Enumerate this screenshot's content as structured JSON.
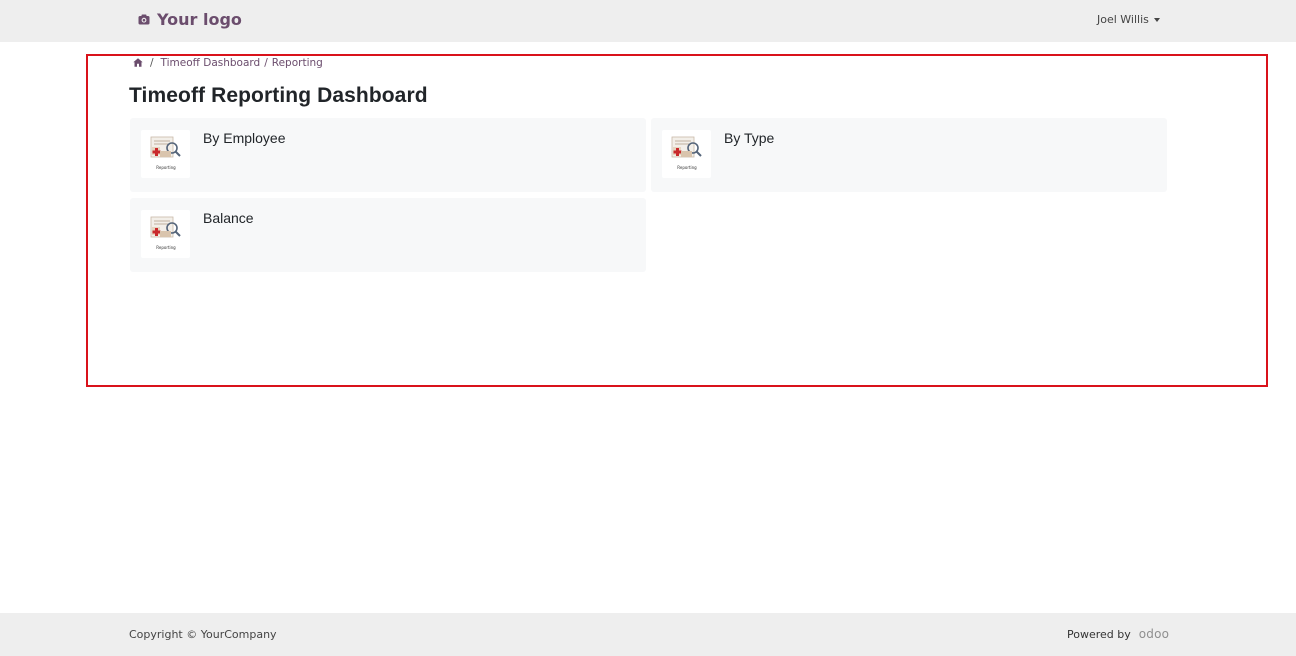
{
  "header": {
    "logo_text": "Your logo",
    "user_name": "Joel Willis"
  },
  "breadcrumb": {
    "link": "Timeoff Dashboard",
    "current": "Reporting"
  },
  "page": {
    "title": "Timeoff Reporting Dashboard"
  },
  "cards": [
    {
      "label": "By Employee",
      "thumb_caption": "Reporting"
    },
    {
      "label": "By Type",
      "thumb_caption": "Reporting"
    },
    {
      "label": "Balance",
      "thumb_caption": "Reporting"
    }
  ],
  "footer": {
    "copyright": "Copyright © YourCompany",
    "powered_by": "Powered by",
    "brand": "odoo"
  },
  "colors": {
    "brand": "#6b4d6d",
    "highlight_frame": "#d9121b"
  }
}
